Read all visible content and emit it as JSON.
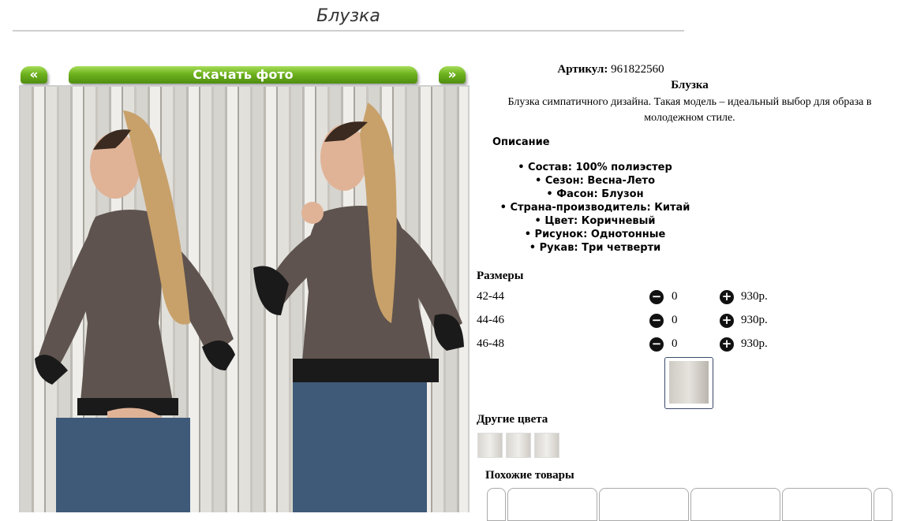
{
  "page": {
    "title": "Блузка"
  },
  "gallery": {
    "prev_label": "«",
    "next_label": "»",
    "download_label": "Скачать фото"
  },
  "product": {
    "article_label": "Артикул:",
    "article_value": "961822560",
    "name": "Блузка",
    "description_line1": "Блузка симпатичного дизайна. Такая модель – идеальный выбор для образа в",
    "description_line2": "молодежном стиле.",
    "description_heading": "Описание",
    "features": [
      "Состав: 100% полиэстер",
      "Сезон: Весна-Лето",
      "Фасон: Блузон",
      "Страна-производитель: Китай",
      "Цвет: Коричневый",
      "Рисунок: Однотонные",
      "Рукав: Три четверти"
    ]
  },
  "sizes": {
    "heading": "Размеры",
    "rows": [
      {
        "size": "42-44",
        "qty": "0",
        "price": "930р."
      },
      {
        "size": "44-46",
        "qty": "0",
        "price": "930р."
      },
      {
        "size": "46-48",
        "qty": "0",
        "price": "930р."
      }
    ]
  },
  "other_colors": {
    "heading": "Другие цвета",
    "count": 3
  },
  "similar": {
    "heading": "Похожие товары"
  },
  "icons": {
    "minus": "minus-circle-icon",
    "plus": "plus-circle-icon"
  },
  "colors": {
    "button_green": "#6eb21e",
    "blouse": "#5e534e",
    "jeans": "#3e5a78"
  }
}
